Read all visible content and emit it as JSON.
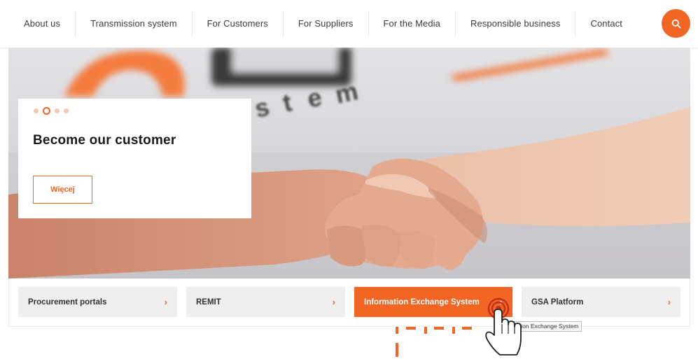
{
  "nav": {
    "items": [
      "About us",
      "Transmission system",
      "For Customers",
      "For Suppliers",
      "For the Media",
      "Responsible business",
      "Contact"
    ]
  },
  "search": {
    "icon": "search-icon"
  },
  "hero": {
    "slide_count": 4,
    "active_slide": 2,
    "title": "Become our customer",
    "button_label": "Więcej"
  },
  "tiles": [
    {
      "label": "Procurement portals",
      "chevron": "›"
    },
    {
      "label": "REMIT",
      "chevron": "›"
    },
    {
      "label": "Information Exchange System",
      "chevron": "›",
      "active": true
    },
    {
      "label": "GSA Platform",
      "chevron": "›"
    }
  ],
  "tooltip": {
    "text": "Information Exchange System"
  },
  "colors": {
    "accent": "#f26522",
    "tile_bg": "#efefef",
    "text_dark": "#1b1b1b"
  }
}
